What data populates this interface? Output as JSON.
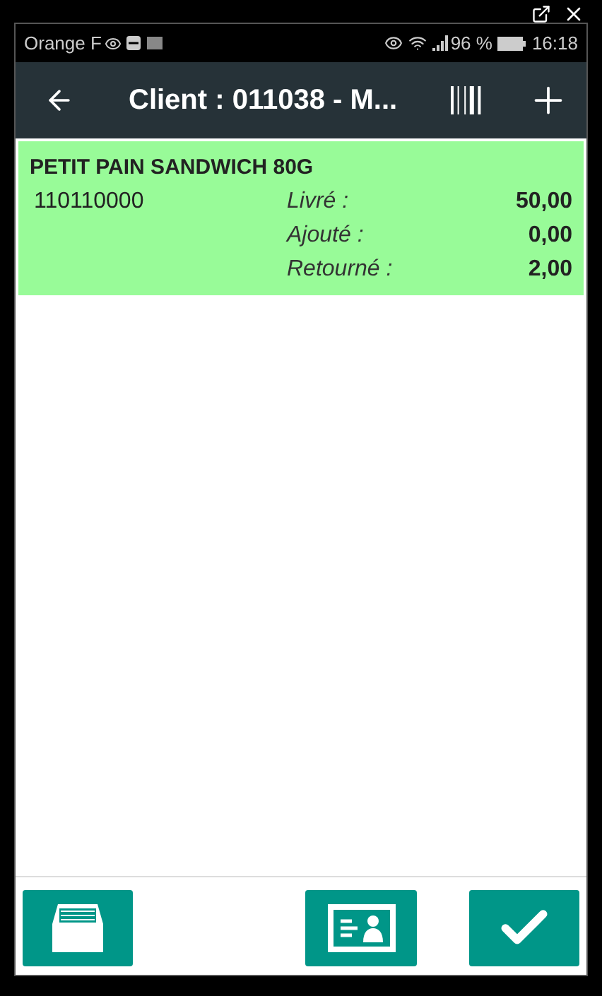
{
  "status_bar": {
    "carrier": "Orange F",
    "battery": "96 %",
    "time": "16:18"
  },
  "toolbar": {
    "title": "Client : 011038 - M..."
  },
  "items": [
    {
      "name": "PETIT PAIN SANDWICH 80G",
      "code": "110110000",
      "color": "#98fb98",
      "fields": [
        {
          "label": "Livré :",
          "value": "50,00"
        },
        {
          "label": "Ajouté :",
          "value": "0,00"
        },
        {
          "label": "Retourné :",
          "value": "2,00"
        }
      ]
    }
  ]
}
